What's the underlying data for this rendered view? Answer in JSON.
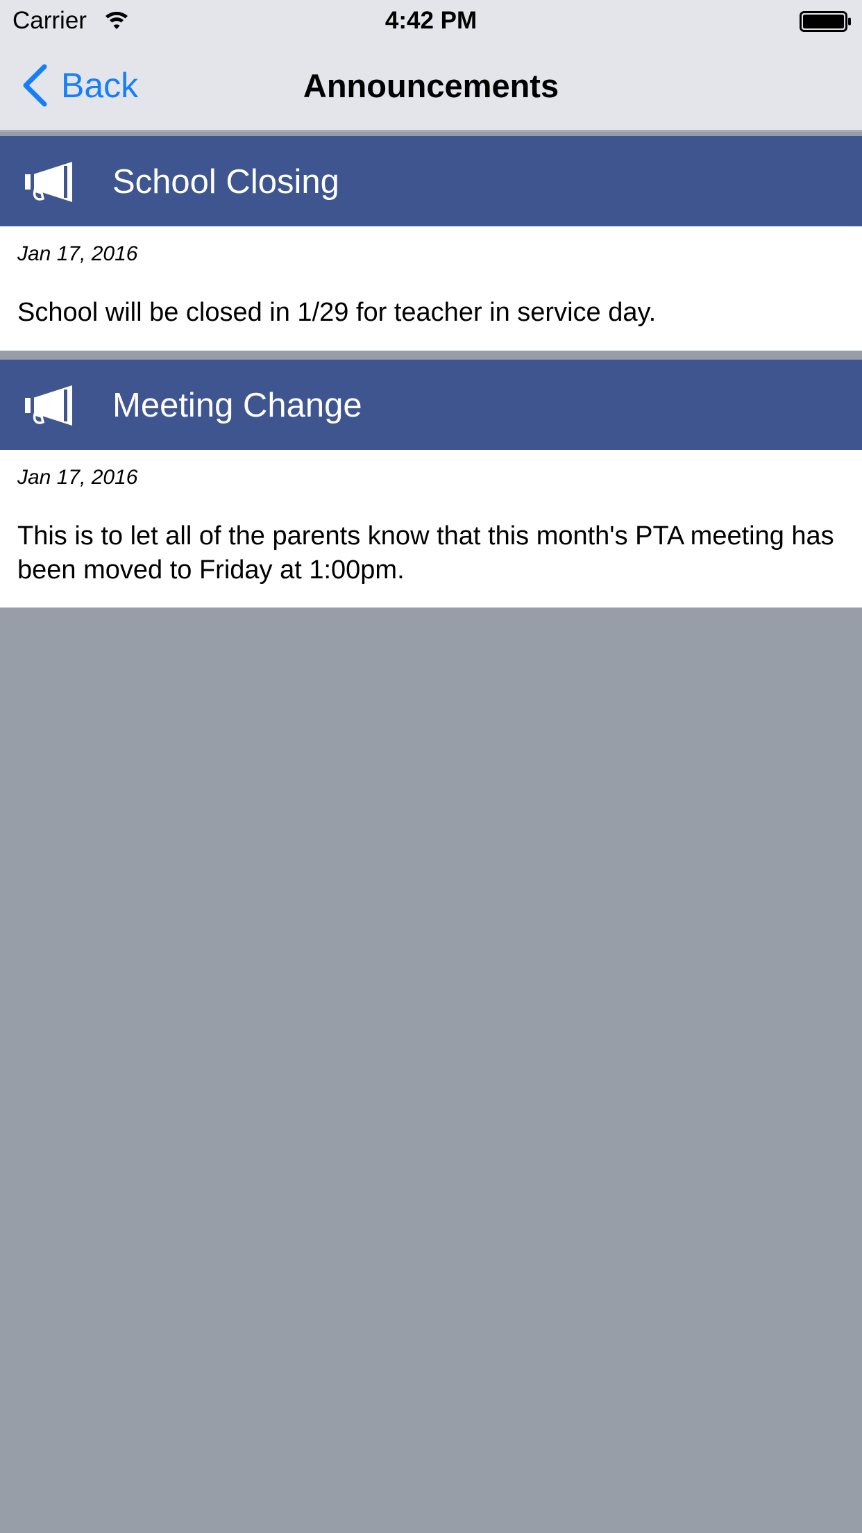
{
  "status_bar": {
    "carrier": "Carrier",
    "time": "4:42 PM",
    "icons": [
      "wifi-icon",
      "battery-icon"
    ]
  },
  "nav": {
    "back_label": "Back",
    "title": "Announcements",
    "back_icon": "chevron-left-icon"
  },
  "announcements": [
    {
      "title": "School Closing",
      "date": "Jan 17, 2016",
      "body": "School will be closed in 1/29 for teacher in service day.",
      "icon": "megaphone-icon"
    },
    {
      "title": "Meeting Change",
      "date": "Jan 17, 2016",
      "body": "This is to let all of the parents know that this month's PTA meeting has been moved to Friday at 1:00pm.",
      "icon": "megaphone-icon"
    }
  ],
  "colors": {
    "accent": "#157efb",
    "header_bg": "#3e5590",
    "page_bg": "#979ea8",
    "bar_bg": "#e3e5ea"
  }
}
